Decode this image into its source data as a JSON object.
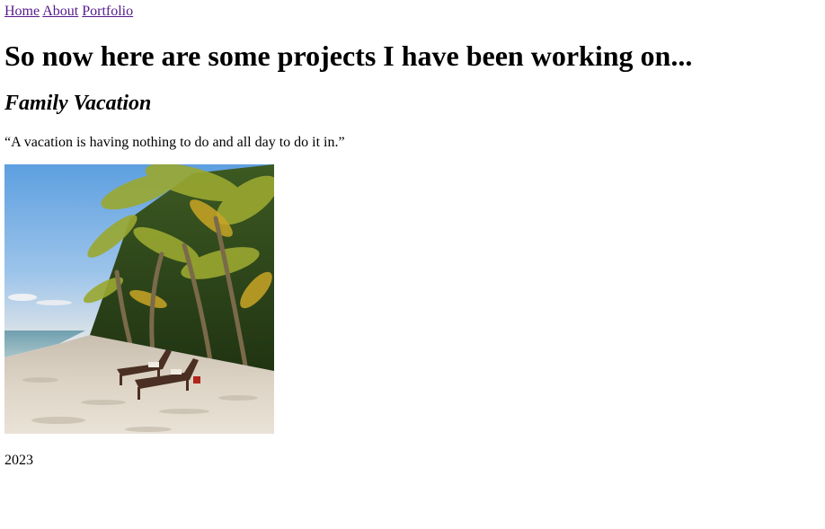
{
  "nav": {
    "links": [
      {
        "label": "Home"
      },
      {
        "label": "About"
      },
      {
        "label": "Portfolio"
      }
    ]
  },
  "main": {
    "title": "So now here are some projects I have been working on...",
    "projects": [
      {
        "title": "Family Vacation",
        "quote": "“A vacation is having nothing to do and all day to do it in.”",
        "year": "2023"
      }
    ]
  }
}
